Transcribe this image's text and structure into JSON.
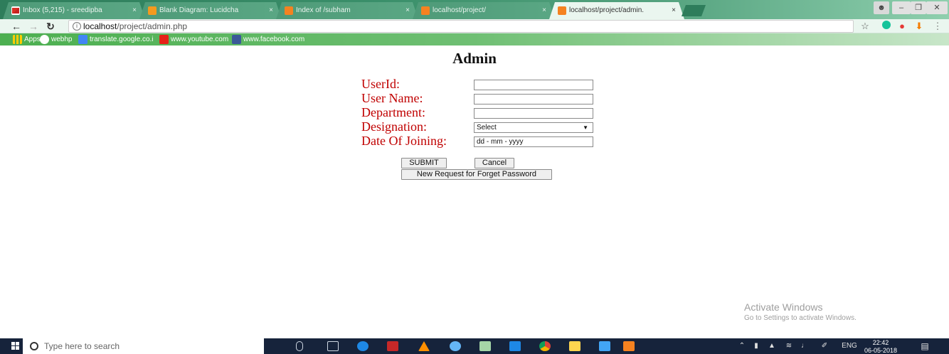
{
  "browser": {
    "tabs": [
      {
        "title": "Inbox (5,215) - sreedipba",
        "icon": "gmail-icon",
        "active": false
      },
      {
        "title": "Blank Diagram: Lucidcha",
        "icon": "lucidchart-icon",
        "active": false
      },
      {
        "title": "Index of /subham",
        "icon": "xampp-icon",
        "active": false
      },
      {
        "title": "localhost/project/",
        "icon": "xampp-icon",
        "active": false
      },
      {
        "title": "localhost/project/admin.",
        "icon": "xampp-icon",
        "active": true
      }
    ],
    "tab_close": "×",
    "address": {
      "host": "localhost",
      "path": "/project/admin.php"
    },
    "bookmarks": [
      {
        "label": "Apps",
        "icon": "apps-grid-icon"
      },
      {
        "label": "webhp",
        "icon": "google-icon"
      },
      {
        "label": "translate.google.co.i",
        "icon": "translate-icon"
      },
      {
        "label": "www.youtube.com",
        "icon": "youtube-icon"
      },
      {
        "label": "www.facebook.com",
        "icon": "facebook-icon"
      }
    ],
    "colors": {
      "tab_strip": "#2e7d5b",
      "bookmark_bar": "#4caf50"
    }
  },
  "page": {
    "title": "Admin",
    "fields": [
      {
        "label": "UserId:",
        "type": "text",
        "value": ""
      },
      {
        "label": "User Name:",
        "type": "text",
        "value": ""
      },
      {
        "label": "Department:",
        "type": "text",
        "value": ""
      },
      {
        "label": "Designation:",
        "type": "select",
        "value": "Select"
      },
      {
        "label": "Date Of Joining:",
        "type": "date",
        "value": "dd - mm - yyyy"
      }
    ],
    "buttons": {
      "submit": "SUBMIT",
      "cancel": "Cancel",
      "forget": "New Request for Forget Password"
    },
    "label_color": "#c00000"
  },
  "watermark": {
    "line1": "Activate Windows",
    "line2": "Go to Settings to activate Windows."
  },
  "taskbar": {
    "search_placeholder": "Type here to search",
    "tray": {
      "language": "ENG",
      "time": "22:42",
      "date": "06-05-2018"
    }
  }
}
